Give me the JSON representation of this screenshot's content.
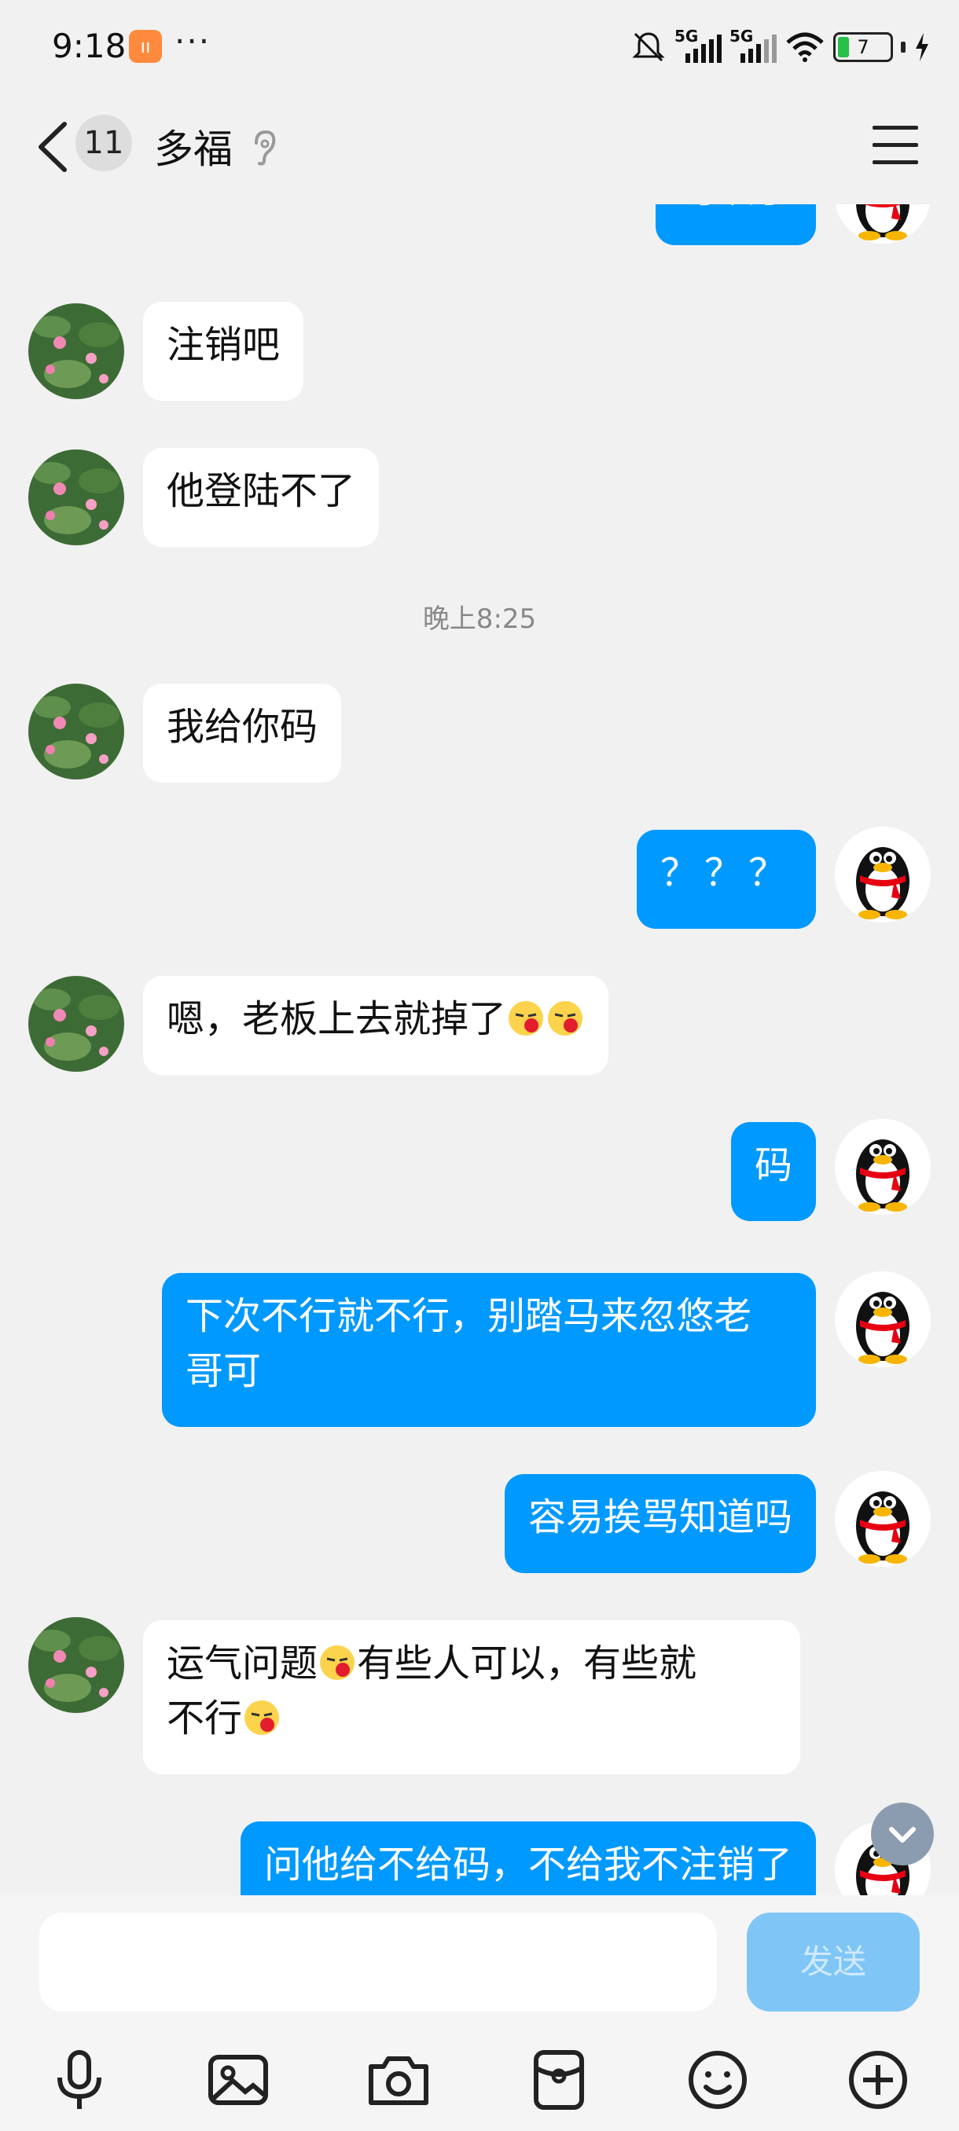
{
  "status_bar": {
    "time": "9:18",
    "app_badge": "ıı",
    "more": "···",
    "signal1_label": "5G",
    "signal2_label": "5G",
    "battery": "7"
  },
  "header": {
    "back_label": "‹",
    "unread_count": "11",
    "title": "多福",
    "menu_icon": "hamburger-menu-icon"
  },
  "messages": [
    {
      "side": "out",
      "text": "可以了"
    },
    {
      "side": "in",
      "text": "注销吧"
    },
    {
      "side": "in",
      "text": "他登陆不了"
    },
    {
      "type": "timestamp",
      "text": "晚上8:25"
    },
    {
      "side": "in",
      "text": "我给你码"
    },
    {
      "side": "out",
      "text": "？？？"
    },
    {
      "side": "in",
      "text": "嗯，老板上去就掉了"
    },
    {
      "side": "out",
      "text": "码"
    },
    {
      "side": "out",
      "text_line1": "下次不行就不行，别踏马来忽悠老",
      "text_line2": "哥可"
    },
    {
      "side": "out",
      "text": "容易挨骂知道吗"
    },
    {
      "side": "in",
      "text_a": "运气问题",
      "text_b": "有些人可以，有些就",
      "text_c": "不行"
    },
    {
      "side": "out",
      "text": "问他给不给码，不给我不注销了"
    }
  ],
  "input_bar": {
    "placeholder": "",
    "send_label": "发送",
    "tools": [
      "microphone-icon",
      "image-icon",
      "camera-icon",
      "red-packet-icon",
      "emoji-icon",
      "plus-icon"
    ]
  },
  "colors": {
    "accent": "#0099ff",
    "background": "#f1f1f1",
    "send_disabled": "#7fc6f7"
  }
}
